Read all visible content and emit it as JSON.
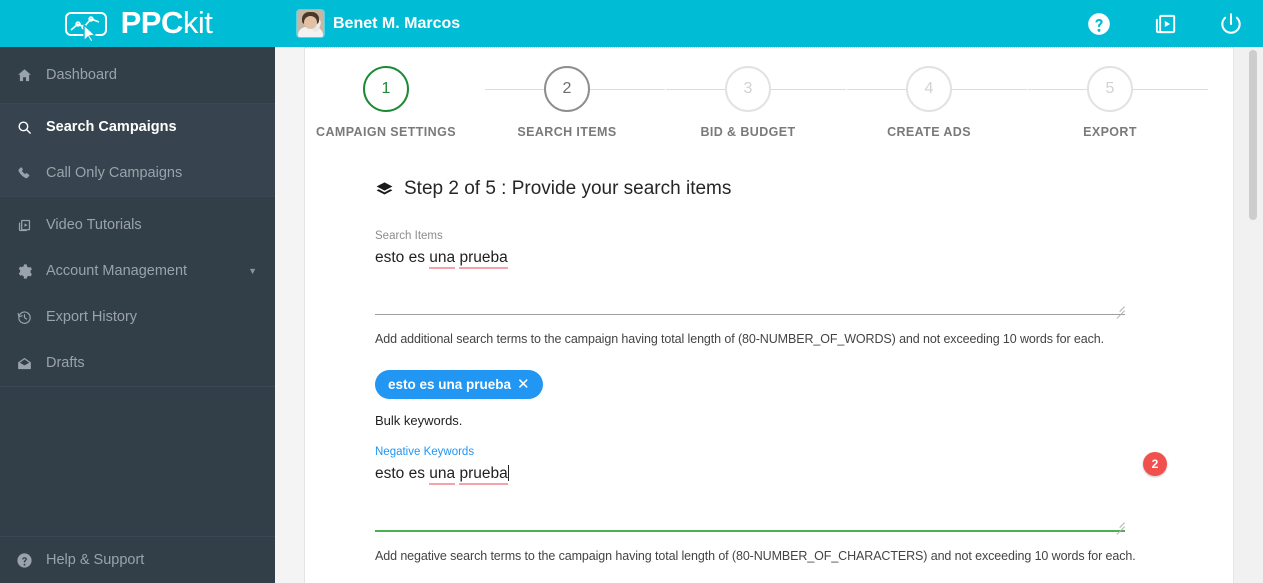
{
  "brand": {
    "bold": "PPC",
    "light": "kit",
    "mark_icon": "chart-cursor-icon"
  },
  "header": {
    "user_name": "Benet M. Marcos",
    "avatar_icon": "user-avatar",
    "actions": [
      {
        "name": "help-icon",
        "label": "Help"
      },
      {
        "name": "video-library-icon",
        "label": "Video"
      },
      {
        "name": "power-icon",
        "label": "Logout"
      }
    ]
  },
  "sidebar": {
    "groups": [
      {
        "highlight": false,
        "items": [
          {
            "label": "Dashboard",
            "icon": "home-icon",
            "active": false,
            "caret": false
          }
        ]
      },
      {
        "highlight": true,
        "items": [
          {
            "label": "Search Campaigns",
            "icon": "search-icon",
            "active": true,
            "caret": false
          },
          {
            "label": "Call Only Campaigns",
            "icon": "phone-icon",
            "active": false,
            "caret": false
          }
        ]
      },
      {
        "highlight": false,
        "items": [
          {
            "label": "Video Tutorials",
            "icon": "video-library-icon",
            "active": false,
            "caret": false
          },
          {
            "label": "Account Management",
            "icon": "gear-icon",
            "active": false,
            "caret": true
          },
          {
            "label": "Export History",
            "icon": "history-icon",
            "active": false,
            "caret": false
          },
          {
            "label": "Drafts",
            "icon": "mail-icon",
            "active": false,
            "caret": false
          }
        ]
      }
    ],
    "bottom": {
      "label": "Help & Support",
      "icon": "help-circle-icon"
    }
  },
  "stepper": {
    "steps": [
      {
        "number": "1",
        "label": "CAMPAIGN SETTINGS",
        "state": "done"
      },
      {
        "number": "2",
        "label": "SEARCH ITEMS",
        "state": "current"
      },
      {
        "number": "3",
        "label": "BID & BUDGET",
        "state": "todo"
      },
      {
        "number": "4",
        "label": "CREATE ADS",
        "state": "todo"
      },
      {
        "number": "5",
        "label": "EXPORT",
        "state": "todo"
      }
    ]
  },
  "main": {
    "section_title": "Step 2 of 5 : Provide your search items",
    "section_icon": "layers-icon",
    "search_items": {
      "label": "Search Items",
      "value": "esto es una prueba",
      "value_plain": "esto es ",
      "misspelled": [
        "una",
        "prueba"
      ],
      "helper": "Add additional search terms to the campaign having total length of (80-NUMBER_OF_WORDS) and not exceeding 10 words for each."
    },
    "chip": {
      "text": "esto es una prueba",
      "remove_icon": "close-icon"
    },
    "bulk_note": "Bulk keywords.",
    "negative_keywords": {
      "label": "Negative Keywords",
      "value": "esto es una prueba",
      "value_plain": "esto es ",
      "misspelled": [
        "una",
        "prueba"
      ],
      "helper": "Add negative search terms to the campaign having total length of (80-NUMBER_OF_CHARACTERS) and not exceeding 10 words for each.",
      "badge_count": "2"
    }
  },
  "colors": {
    "brand_cyan": "#00bcd4",
    "sidebar": "#323e48",
    "accent_blue": "#2196f3",
    "success_green": "#4caf50",
    "step_done_green": "#1d8a35",
    "badge_red": "#f0514f",
    "spellcheck_underline": "#f4a3ad"
  }
}
